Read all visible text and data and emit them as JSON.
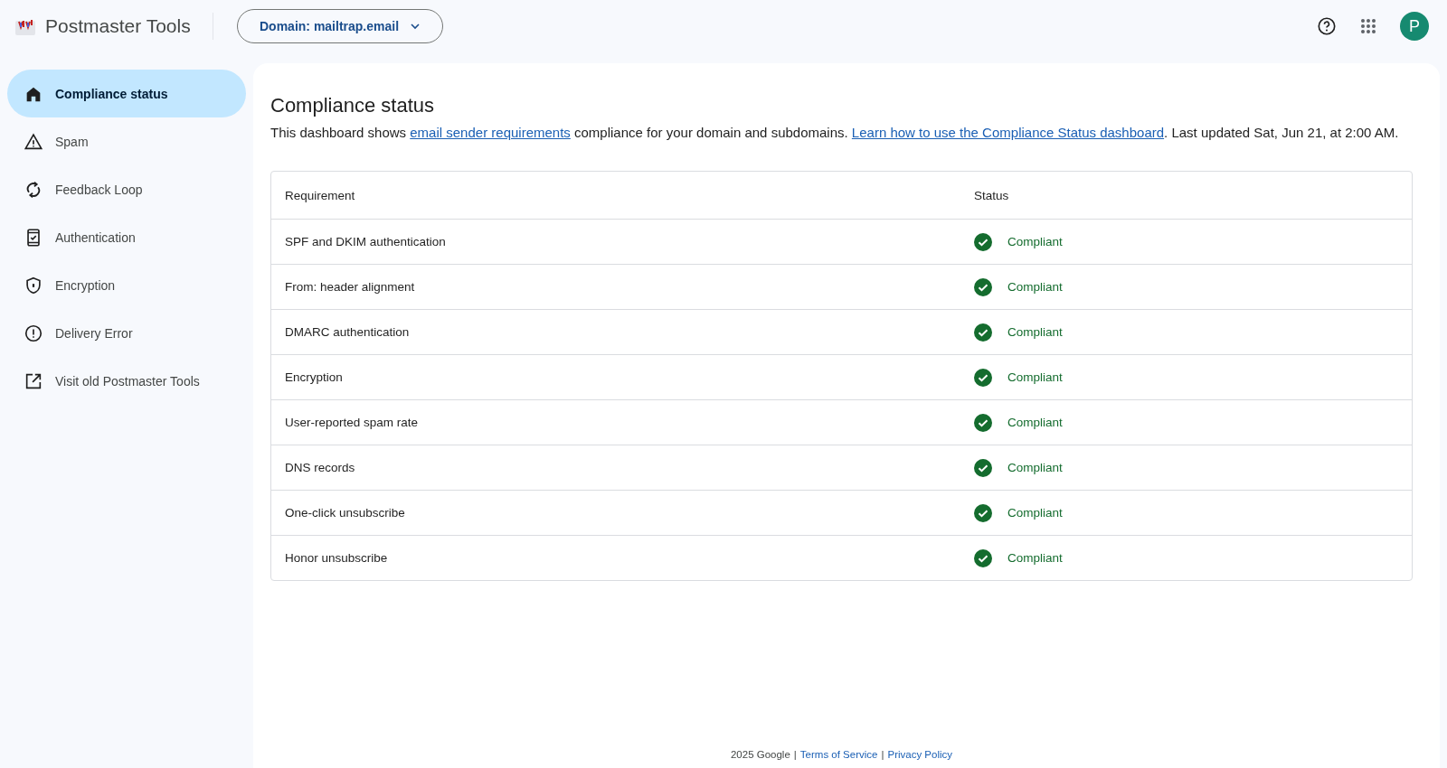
{
  "app": {
    "title": "Postmaster Tools"
  },
  "domain_selector": {
    "label": "Domain: mailtrap.email"
  },
  "account": {
    "initial": "P"
  },
  "sidebar": {
    "items": [
      {
        "label": "Compliance status",
        "kind": "home",
        "selected": true
      },
      {
        "label": "Spam",
        "kind": "warning",
        "selected": false
      },
      {
        "label": "Feedback Loop",
        "kind": "sync",
        "selected": false
      },
      {
        "label": "Authentication",
        "kind": "device-check",
        "selected": false
      },
      {
        "label": "Encryption",
        "kind": "shield",
        "selected": false
      },
      {
        "label": "Delivery Error",
        "kind": "error",
        "selected": false
      },
      {
        "label": "Visit old Postmaster Tools",
        "kind": "external",
        "selected": false
      }
    ]
  },
  "page": {
    "title": "Compliance status",
    "description": [
      {
        "kind": "text",
        "text": "This dashboard shows "
      },
      {
        "kind": "link",
        "text": "email sender requirements"
      },
      {
        "kind": "text",
        "text": " compliance for your domain and subdomains. "
      },
      {
        "kind": "link",
        "text": "Learn how to use the Compliance Status dashboard"
      },
      {
        "kind": "text",
        "text": ". Last updated Sat, Jun 21, at 2:00 AM."
      }
    ]
  },
  "table": {
    "columns": [
      "Requirement",
      "Status"
    ],
    "rows": [
      {
        "requirement": "SPF and DKIM authentication",
        "status": "Compliant",
        "kind": "compliant"
      },
      {
        "requirement": "From: header alignment",
        "status": "Compliant",
        "kind": "compliant"
      },
      {
        "requirement": "DMARC authentication",
        "status": "Compliant",
        "kind": "compliant"
      },
      {
        "requirement": "Encryption",
        "status": "Compliant",
        "kind": "compliant"
      },
      {
        "requirement": "User-reported spam rate",
        "status": "Compliant",
        "kind": "compliant"
      },
      {
        "requirement": "DNS records",
        "status": "Compliant",
        "kind": "compliant"
      },
      {
        "requirement": "One-click unsubscribe",
        "status": "Compliant",
        "kind": "compliant"
      },
      {
        "requirement": "Honor unsubscribe",
        "status": "Compliant",
        "kind": "compliant"
      }
    ]
  },
  "footer": {
    "copyright": "2025 Google",
    "separator": "|",
    "links": [
      "Terms of Service",
      "Privacy Policy"
    ]
  }
}
